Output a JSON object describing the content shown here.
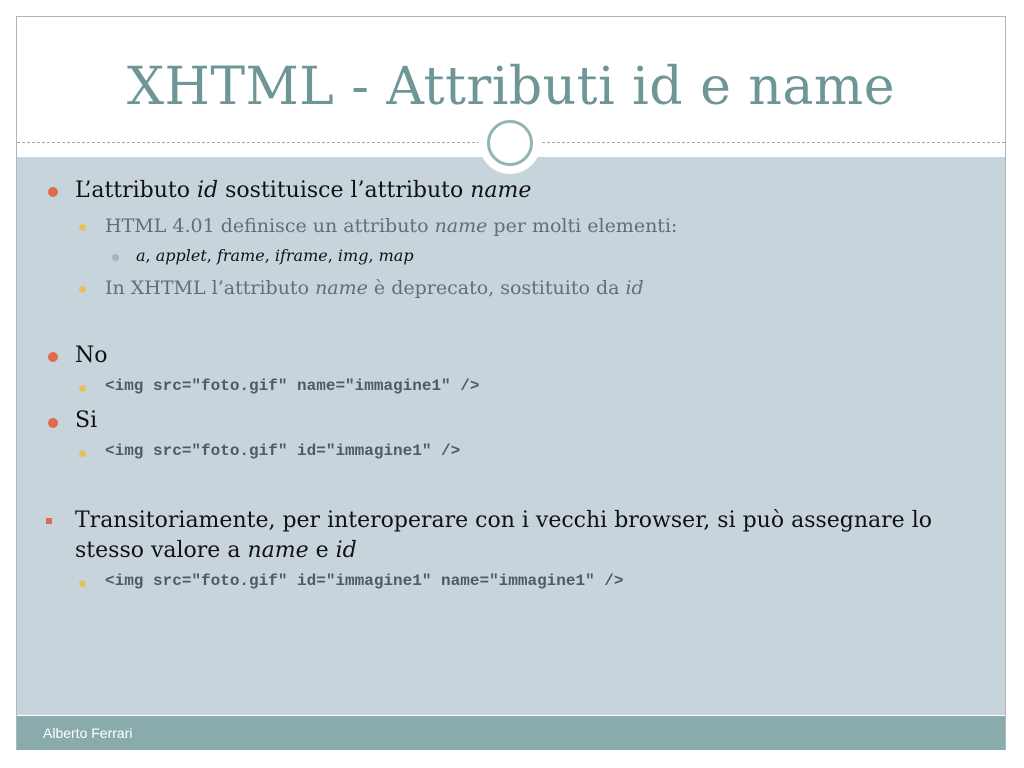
{
  "slide": {
    "title": "XHTML - Attributi id e name",
    "footer_author": "Alberto Ferrari"
  },
  "colors": {
    "title": "#6f9697",
    "content_bg": "#c8d4dc",
    "footer_bg": "#8aabab",
    "bullet_level1": "#e06a4e",
    "bullet_level2": "#e4c25a",
    "bullet_level3": "#9fb8bd"
  },
  "content": {
    "b1": {
      "pre": "L’attributo ",
      "em1": "id",
      "mid": " sostituisce l’attributo ",
      "em2": "name"
    },
    "b1_1": {
      "pre": "HTML 4.01 definisce un attributo ",
      "em": "name",
      "post": " per molti elementi:"
    },
    "b1_1_1": {
      "a": "a",
      "sep1": ", ",
      "applet": "applet",
      "sep2": ", ",
      "frame": "frame",
      "sep3": ", ",
      "iframe": "iframe",
      "sep4": ", ",
      "img": "img",
      "sep5": ", ",
      "map": "map"
    },
    "b1_2": {
      "pre": "In XHTML l’attributo ",
      "em1": "name",
      "mid": " è deprecato, sostituito da ",
      "em2": "id"
    },
    "b2": "No",
    "b2_code": "<img src=\"foto.gif\" name=\"immagine1\" />",
    "b3": "Si",
    "b3_code": "<img src=\"foto.gif\" id=\"immagine1\" />",
    "b4": {
      "pre": "Transitoriamente, per interoperare con i vecchi browser, si può assegnare lo stesso valore a ",
      "em1": "name",
      "mid": " e ",
      "em2": "id"
    },
    "b4_code": "<img src=\"foto.gif\" id=\"immagine1\" name=\"immagine1\" />"
  }
}
